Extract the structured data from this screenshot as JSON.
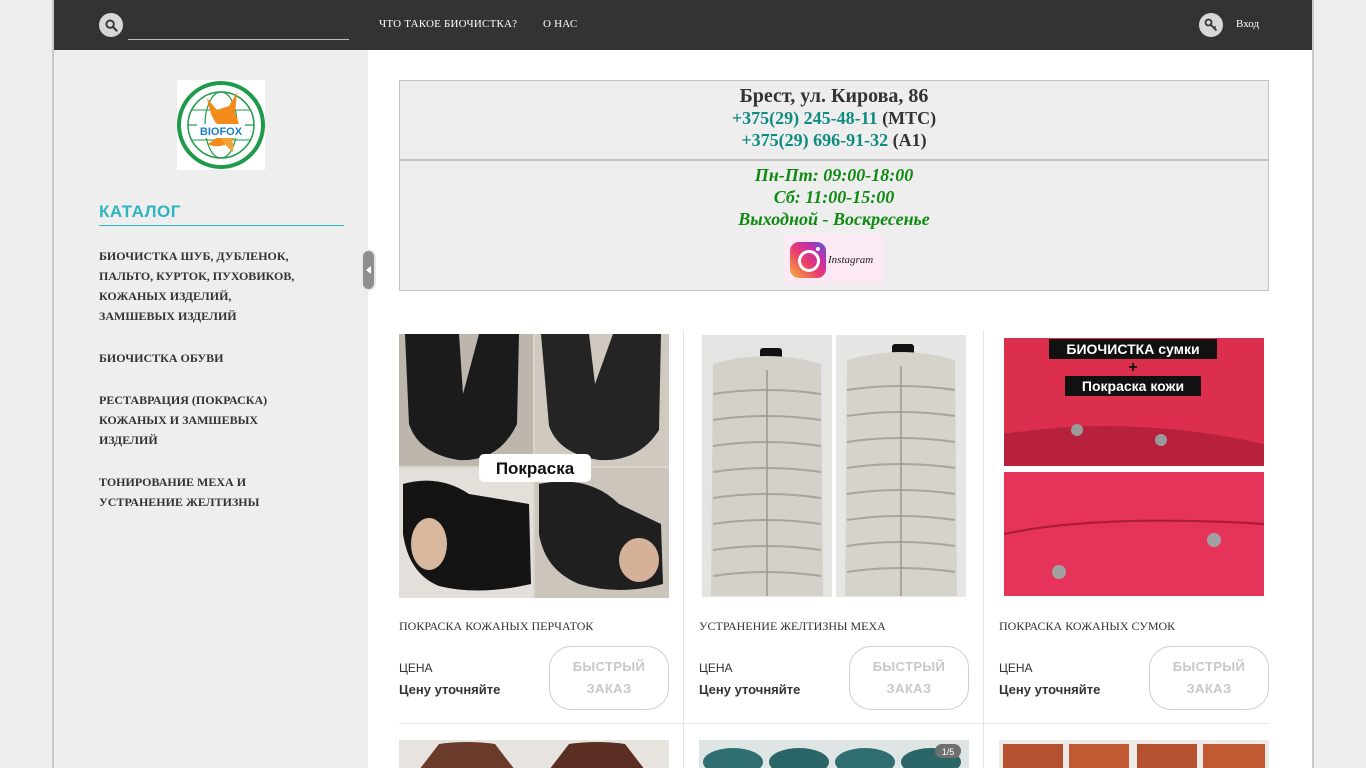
{
  "topbar": {
    "search_placeholder": "",
    "nav": [
      "ЧТО ТАКОЕ БИОЧИСТКА?",
      "О НАС"
    ],
    "login": "Вход"
  },
  "sidebar": {
    "logo_text": "BIOFOX",
    "logo_subtext": "ЦЕНТР БИОЧИСТКИ",
    "catalog_title": "КАТАЛОГ",
    "items": [
      [
        "БИОЧИСТКА ШУБ, ДУБЛЕНОК,",
        "ПАЛЬТО, КУРТОК, ПУХОВИКОВ,",
        "КОЖАНЫХ ИЗДЕЛИЙ,",
        "ЗАМШЕВЫХ ИЗДЕЛИЙ"
      ],
      [
        "БИОЧИСТКА ОБУВИ"
      ],
      [
        "РЕСТАВРАЦИЯ (ПОКРАСКА)",
        "КОЖАНЫХ И ЗАМШЕВЫХ",
        "ИЗДЕЛИЙ"
      ],
      [
        "ТОНИРОВАНИЕ МЕХА И",
        "УСТРАНЕНИЕ ЖЕЛТИЗНЫ"
      ]
    ]
  },
  "contact": {
    "address": "Брест, ул. Кирова, 86",
    "phone1": "+375(29) 245-48-11",
    "phone1_op": " (МТС)",
    "phone2": "+375(29) 696-91-32",
    "phone2_op": " (А1)",
    "hours1": "Пн-Пт:  09:00-18:00",
    "hours2": "Сб:  11:00-15:00",
    "hours3": "Выходной - Воскресенье",
    "instagram": "Instagram"
  },
  "products": [
    {
      "title": "ПОКРАСКА КОЖАНЫХ ПЕРЧАТОК",
      "price_label": "ЦЕНА",
      "price": "Цену уточняйте",
      "button": "БЫСТРЫЙ ЗАКАЗ",
      "image_caption": "Покраска"
    },
    {
      "title": "УСТРАНЕНИЕ ЖЕЛТИЗНЫ МЕХА",
      "price_label": "ЦЕНА",
      "price": "Цену уточняйте",
      "button": "БЫСТРЫЙ ЗАКАЗ",
      "image_caption": ""
    },
    {
      "title": "ПОКРАСКА КОЖАНЫХ СУМОК",
      "price_label": "ЦЕНА",
      "price": "Цену уточняйте",
      "button": "БЫСТРЫЙ ЗАКАЗ",
      "image_caption_1": "БИОЧИСТКА сумки",
      "image_caption_plus": "+",
      "image_caption_2": "Покраска кожи"
    }
  ],
  "row2_badge": "1/5",
  "colors": {
    "topbar": "#333333",
    "accent": "#2ab5bf",
    "phone": "#0f8c80",
    "hours": "#0f8a12"
  }
}
